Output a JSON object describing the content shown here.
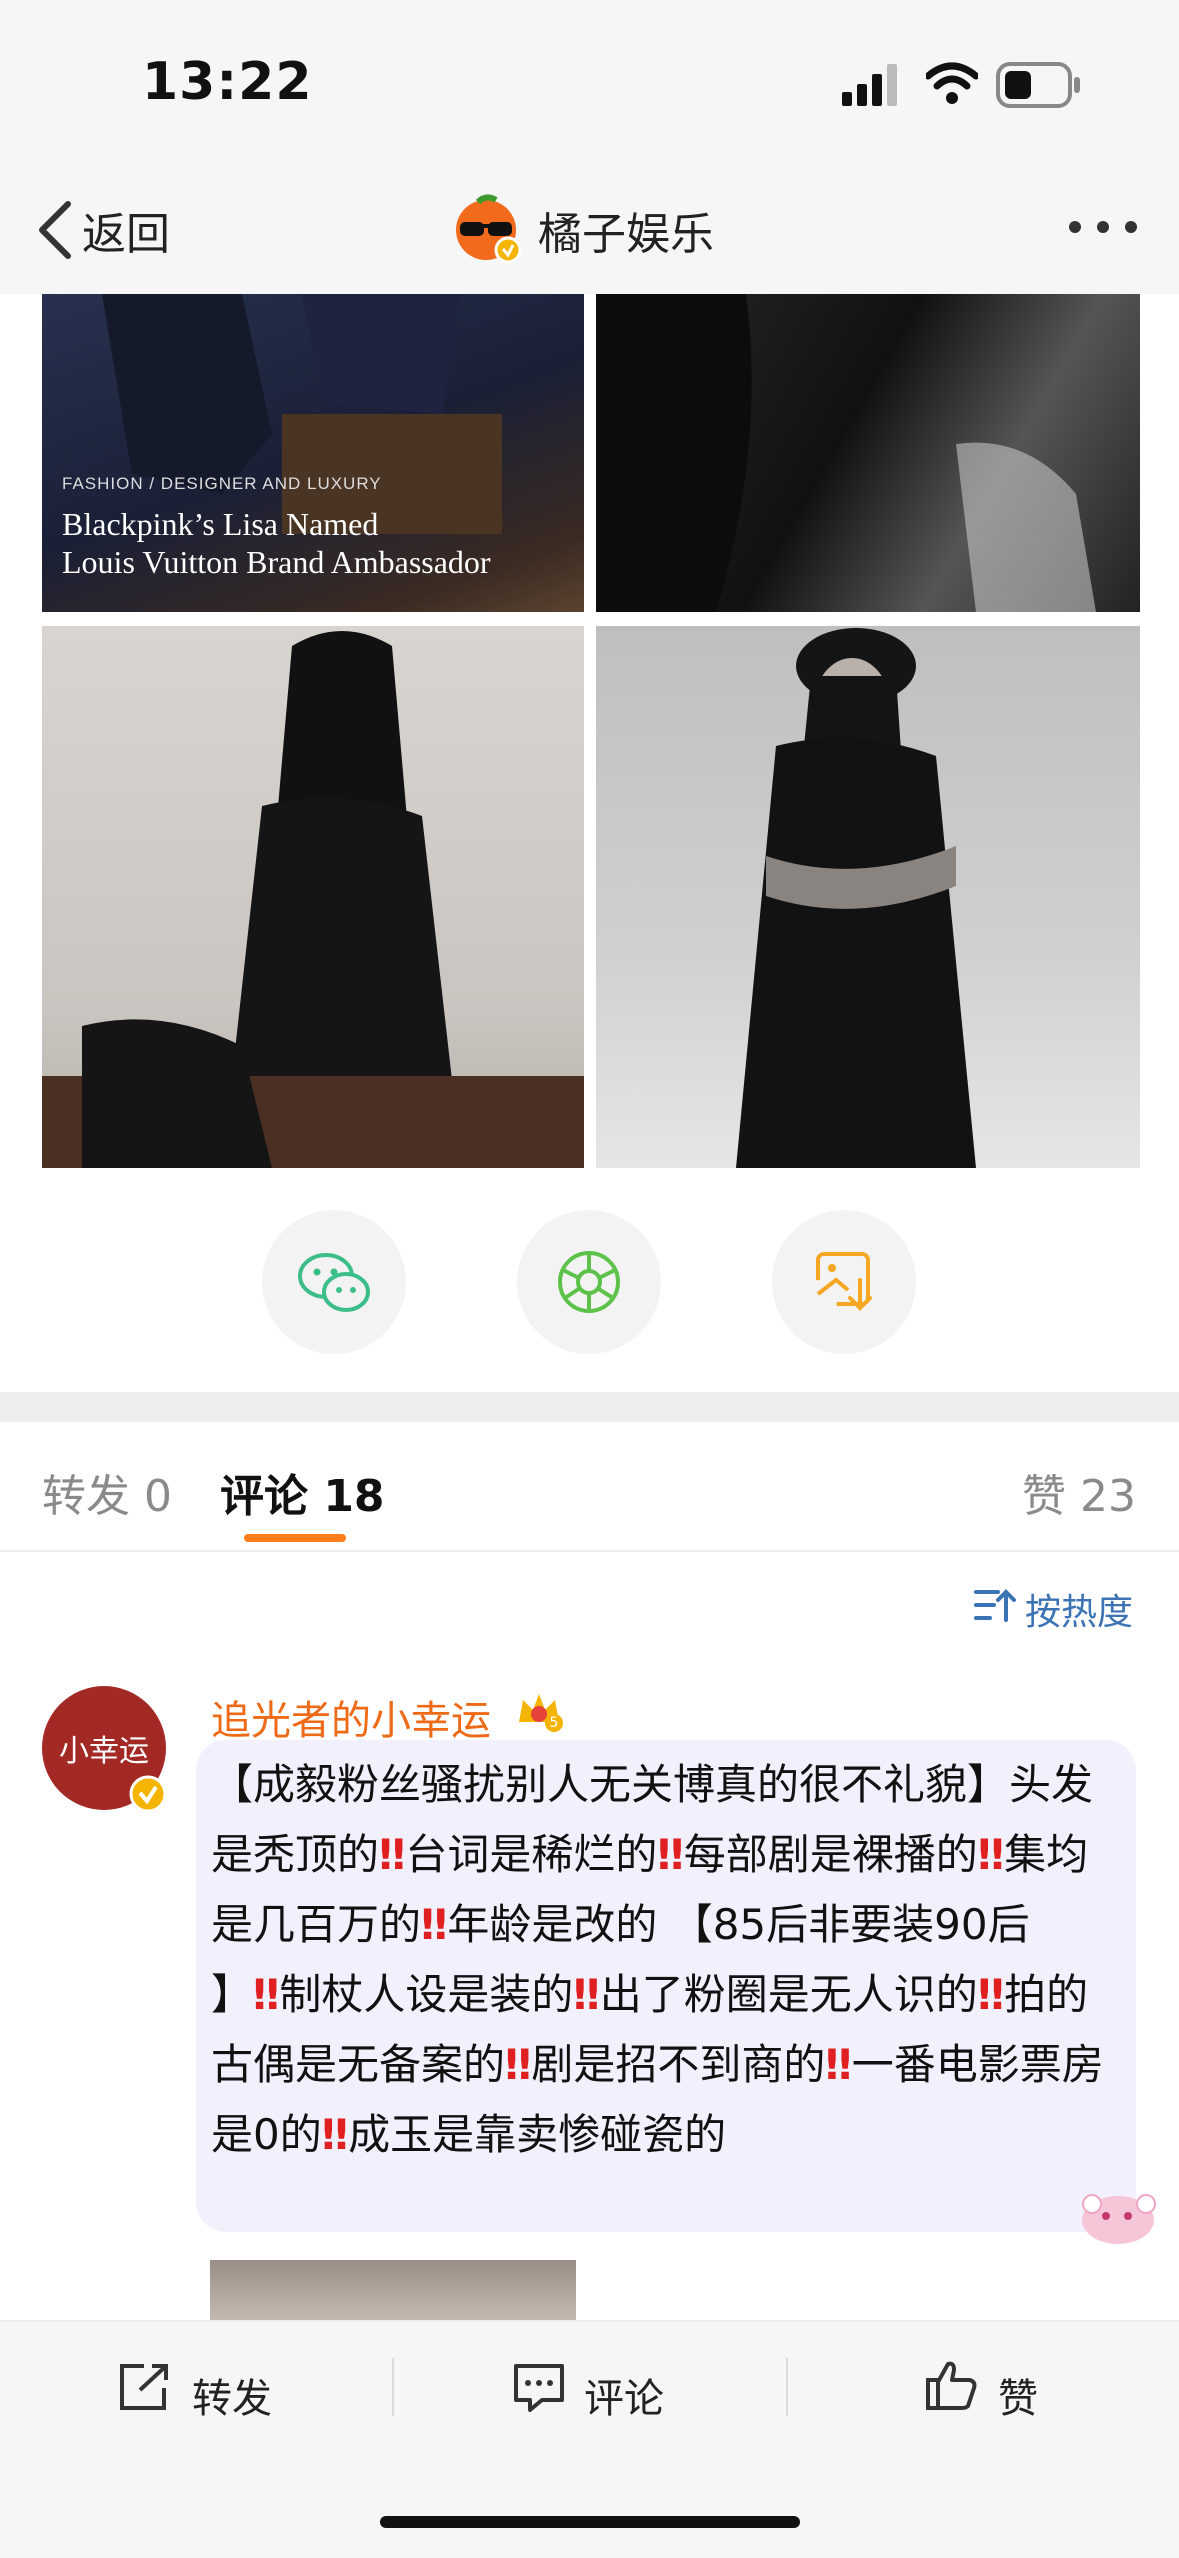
{
  "status_bar": {
    "time": "13:22"
  },
  "nav": {
    "back_label": "返回",
    "title": "橘子娱乐",
    "more_label": "• • •"
  },
  "post_image": {
    "caption_small": "FASHION / DESIGNER AND LUXURY",
    "caption_line1": "Blackpink’s Lisa Named",
    "caption_line2": "Louis Vuitton Brand Ambassador"
  },
  "share": {
    "wechat_icon": "wechat-icon",
    "moments_icon": "moments-icon",
    "save_image_icon": "save-image-icon"
  },
  "tabs": {
    "repost": "转发 0",
    "comment": "评论 18",
    "like": "赞 23"
  },
  "sort": {
    "label": "按热度"
  },
  "comment": {
    "avatar_text": "小幸运",
    "username": "追光者的小幸运",
    "badge_level": "5",
    "text": "【成毅粉丝骚扰别人无关博真的很不礼貌】头发是秃顶的‼️台词是稀烂的‼️每部剧是裸播的‼️集均是几百万的‼️年龄是改的 【85后非要装90后 】‼️制杖人设是装的‼️出了粉圈是无人识的‼️拍的古偶是无备案的‼️剧是招不到商的‼️一番电影票房是0的‼️成玉是靠卖惨碰瓷的"
  },
  "bottom_bar": {
    "repost": "转发",
    "comment": "评论",
    "like": "赞"
  },
  "colors": {
    "accent_orange": "#ff7d1a",
    "username_orange": "#ee6a17",
    "link_blue": "#3b73b5",
    "bubble_bg": "#f1f0fc",
    "red_mark": "#e02020"
  }
}
